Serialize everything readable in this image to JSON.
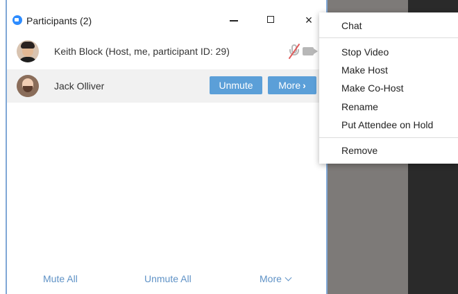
{
  "window": {
    "title": "Participants (2)",
    "minimize_icon": "minimize-icon",
    "maximize_icon": "maximize-icon",
    "close_label": "×"
  },
  "participants": [
    {
      "name": "Keith Block (Host, me, participant ID: 29)",
      "mic_icon": "mic-muted-icon",
      "video_icon": "camera-icon"
    },
    {
      "name": "Jack Olliver",
      "unmute_label": "Unmute",
      "more_label": "More",
      "more_chevron": "›"
    }
  ],
  "footer": {
    "mute_all": "Mute All",
    "unmute_all": "Unmute All",
    "more": "More"
  },
  "context_menu": {
    "items": [
      {
        "label": "Chat"
      },
      {
        "label": "Stop Video"
      },
      {
        "label": "Make Host"
      },
      {
        "label": "Make Co-Host"
      },
      {
        "label": "Rename"
      },
      {
        "label": "Put Attendee on Hold"
      },
      {
        "label": "Remove"
      }
    ]
  },
  "colors": {
    "accent_blue": "#5b9fd8",
    "link_blue": "#5f92c6",
    "muted_red": "#e05a5a",
    "logo_blue": "#2d8cff"
  }
}
